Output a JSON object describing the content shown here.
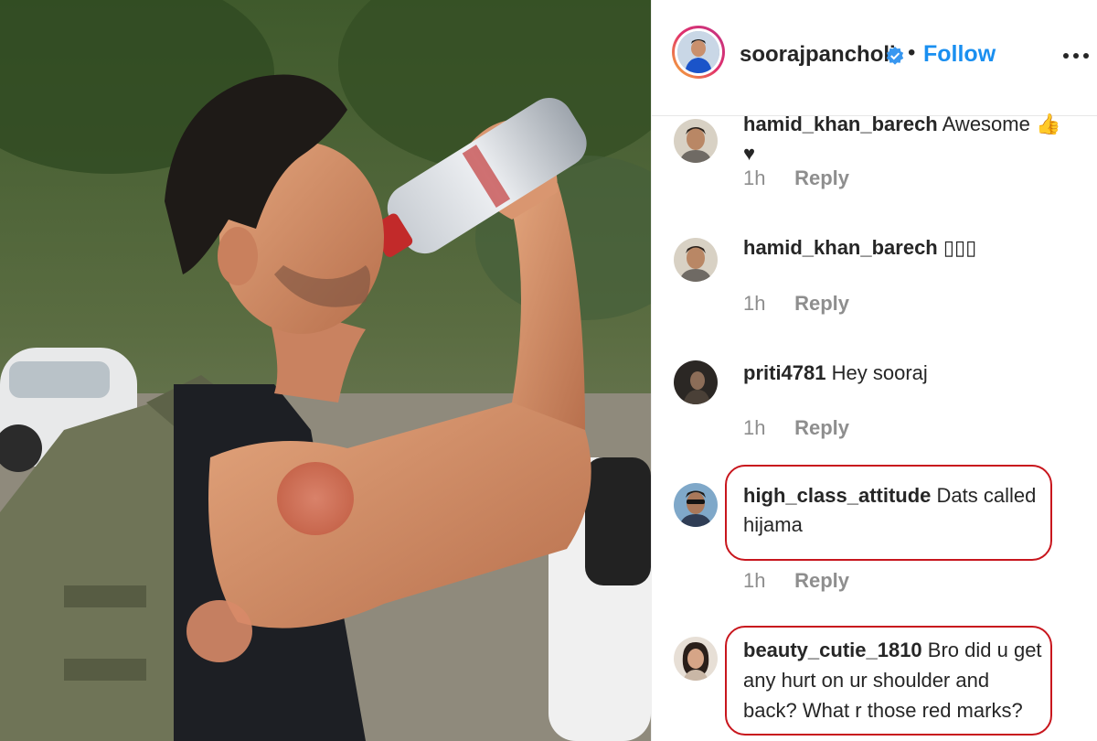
{
  "post": {
    "username": "soorajpancholi",
    "separator": "•",
    "follow_label": "Follow",
    "more_label": "•••"
  },
  "comments": [
    {
      "username": "hamid_khan_barech",
      "text": "Awesome 👍♥",
      "time": "1h",
      "reply_label": "Reply",
      "highlighted": false
    },
    {
      "username": "hamid_khan_barech",
      "text": "▯▯▯",
      "time": "1h",
      "reply_label": "Reply",
      "highlighted": false
    },
    {
      "username": "priti4781",
      "text": "Hey sooraj",
      "time": "1h",
      "reply_label": "Reply",
      "highlighted": false
    },
    {
      "username": "high_class_attitude",
      "text": "Dats called hijama",
      "time": "1h",
      "reply_label": "Reply",
      "highlighted": true
    },
    {
      "username": "beauty_cutie_1810",
      "text": "Bro did u get any hurt on ur shoulder and back? What r those red marks?",
      "time": "",
      "reply_label": "",
      "highlighted": true
    }
  ],
  "colors": {
    "follow": "#1a8ff0",
    "verified": "#3897f0",
    "highlight_border": "#c8161d",
    "muted_text": "#8e8e8e"
  },
  "icons": [
    "verified-badge-icon",
    "more-options-icon"
  ]
}
